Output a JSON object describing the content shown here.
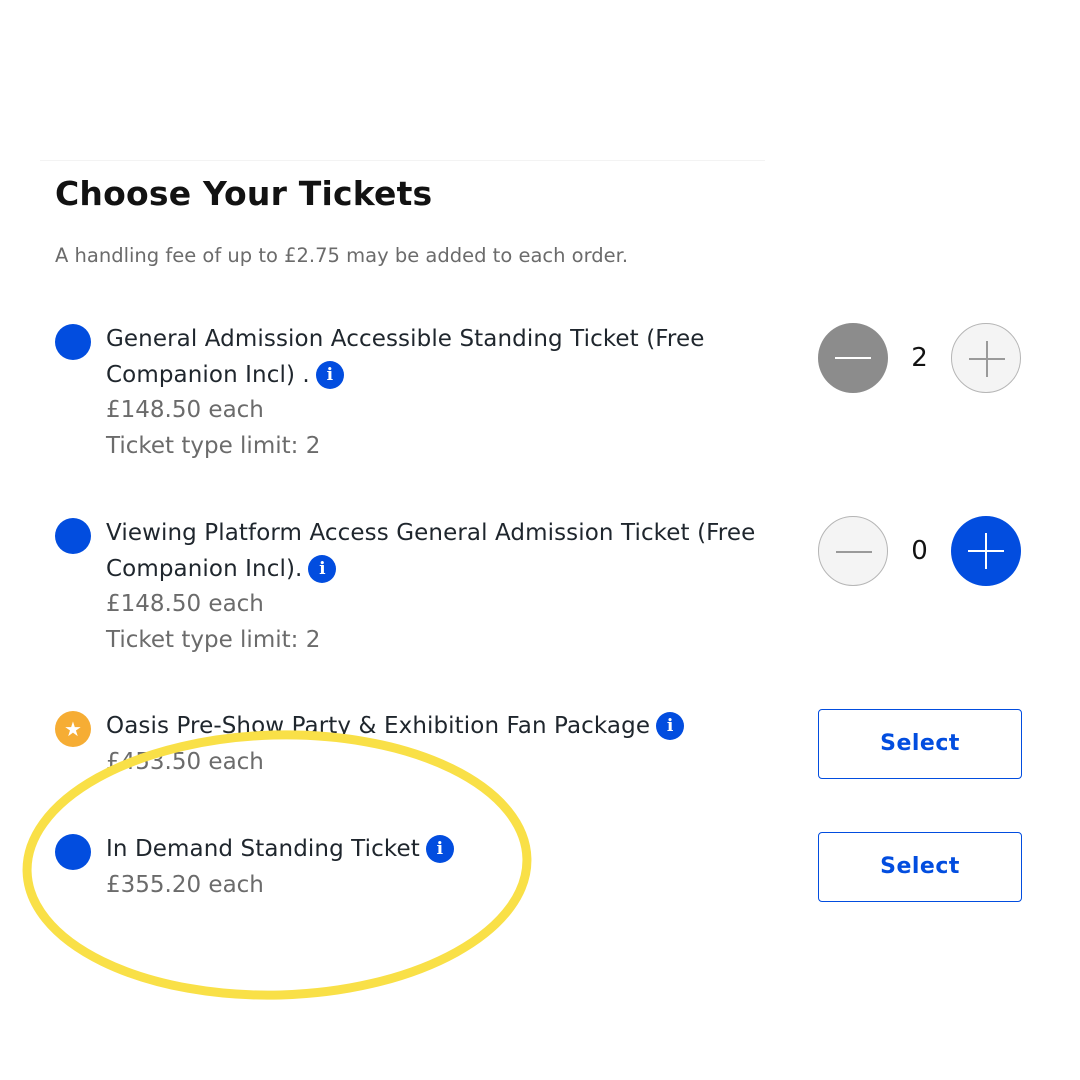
{
  "page": {
    "title": "Choose Your Tickets",
    "fee_note": "A handling fee of up to £2.75 may be added to each order."
  },
  "tickets": [
    {
      "name": "General Admission Accessible Standing Ticket (Free Companion Incl) .",
      "price": "£148.50 each",
      "limit": "Ticket type limit: 2",
      "quantity": "2",
      "marker": "blue-dot"
    },
    {
      "name": "Viewing Platform Access General Admission Ticket (Free Companion Incl).",
      "price": "£148.50 each",
      "limit": "Ticket type limit: 2",
      "quantity": "0",
      "marker": "blue-dot"
    },
    {
      "name": "Oasis Pre-Show Party & Exhibition Fan Package",
      "price": "£453.50 each",
      "action_label": "Select",
      "marker": "star-icon"
    },
    {
      "name": "In Demand Standing Ticket",
      "price": "£355.20 each",
      "action_label": "Select",
      "marker": "blue-dot"
    }
  ],
  "icons": {
    "info": "i",
    "star": "★"
  },
  "colors": {
    "brand_blue": "#024ddf",
    "star_orange": "#f6ad34",
    "disabled_grey": "#8c8c8c",
    "annotation_yellow": "#f9e047"
  }
}
